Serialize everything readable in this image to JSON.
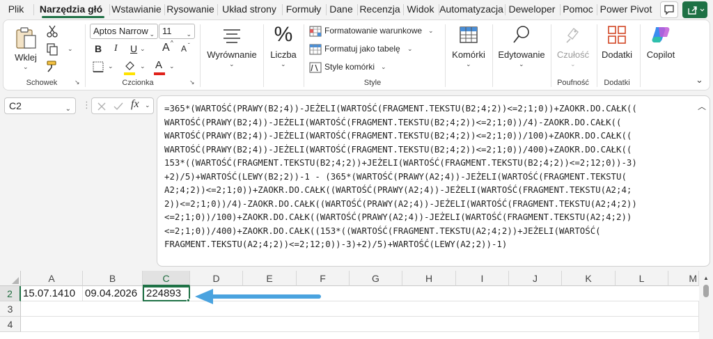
{
  "tabs": [
    "Plik",
    "Narzędzia głó",
    "Wstawianie",
    "Rysowanie",
    "Układ strony",
    "Formuły",
    "Dane",
    "Recenzja",
    "Widok",
    "Automatyzacja",
    "Deweloper",
    "Pomoc",
    "Power Pivot"
  ],
  "active_tab": "Narzędzia głó",
  "ribbon": {
    "clipboard": {
      "paste_label": "Wklej",
      "group_label": "Schowek"
    },
    "font": {
      "font_name": "Aptos Narrow",
      "font_size": "11",
      "group_label": "Czcionka",
      "bold": "B",
      "italic": "I",
      "underline": "U",
      "grow": "A",
      "shrink": "A",
      "highlight_color": "#ffe200",
      "font_color": "#e0221b"
    },
    "alignment": {
      "label": "Wyrównanie"
    },
    "number": {
      "label": "Liczba",
      "icon_text": "%"
    },
    "styles": {
      "conditional": "Formatowanie warunkowe",
      "as_table": "Formatuj jako tabelę",
      "cell_styles": "Style komórki",
      "group_label": "Style"
    },
    "cells": {
      "label": "Komórki"
    },
    "editing": {
      "label": "Edytowanie"
    },
    "sensitivity": {
      "label": "Czułość",
      "group_label": "Poufność"
    },
    "addins": {
      "label": "Dodatki",
      "group_label": "Dodatki"
    },
    "copilot": {
      "label": "Copilot"
    }
  },
  "formula_bar": {
    "name_box": "C2",
    "fx": "fx",
    "lines": [
      "=365*(WARTOŚĆ(PRAWY(B2;4))-JEŻELI(WARTOŚĆ(FRAGMENT.TEKSTU(B2;4;2))<=2;1;0))+ZAOKR.DO.CAŁK((",
      "WARTOŚĆ(PRAWY(B2;4))-JEŻELI(WARTOŚĆ(FRAGMENT.TEKSTU(B2;4;2))<=2;1;0))/4)-ZAOKR.DO.CAŁK((",
      "WARTOŚĆ(PRAWY(B2;4))-JEŻELI(WARTOŚĆ(FRAGMENT.TEKSTU(B2;4;2))<=2;1;0))/100)+ZAOKR.DO.CAŁK((",
      "WARTOŚĆ(PRAWY(B2;4))-JEŻELI(WARTOŚĆ(FRAGMENT.TEKSTU(B2;4;2))<=2;1;0))/400)+ZAOKR.DO.CAŁK((",
      "153*((WARTOŚĆ(FRAGMENT.TEKSTU(B2;4;2))+JEŻELI(WARTOŚĆ(FRAGMENT.TEKSTU(B2;4;2))<=2;12;0))-3)",
      "+2)/5)+WARTOŚĆ(LEWY(B2;2))-1 - (365*(WARTOŚĆ(PRAWY(A2;4))-JEŻELI(WARTOŚĆ(FRAGMENT.TEKSTU(",
      "A2;4;2))<=2;1;0))+ZAOKR.DO.CAŁK((WARTOŚĆ(PRAWY(A2;4))-JEŻELI(WARTOŚĆ(FRAGMENT.TEKSTU(A2;4;",
      "2))<=2;1;0))/4)-ZAOKR.DO.CAŁK((WARTOŚĆ(PRAWY(A2;4))-JEŻELI(WARTOŚĆ(FRAGMENT.TEKSTU(A2;4;2))",
      "<=2;1;0))/100)+ZAOKR.DO.CAŁK((WARTOŚĆ(PRAWY(A2;4))-JEŻELI(WARTOŚĆ(FRAGMENT.TEKSTU(A2;4;2))",
      "<=2;1;0))/400)+ZAOKR.DO.CAŁK((153*((WARTOŚĆ(FRAGMENT.TEKSTU(A2;4;2))+JEŻELI(WARTOŚĆ(",
      "FRAGMENT.TEKSTU(A2;4;2))<=2;12;0))-3)+2)/5)+WARTOŚĆ(LEWY(A2;2))-1)"
    ]
  },
  "grid": {
    "columns": [
      "A",
      "B",
      "C",
      "D",
      "E",
      "F",
      "G",
      "H",
      "I",
      "J",
      "K",
      "L",
      "M"
    ],
    "selected_column": "C",
    "rows": [
      "2",
      "3",
      "4"
    ],
    "selected_row": "2",
    "cells": {
      "A2": "15.07.1410",
      "B2": "09.04.2026",
      "C2": "224893"
    },
    "active_cell": "C2"
  },
  "colors": {
    "accent_green": "#1e7145",
    "arrow_blue": "#4aa3df"
  }
}
